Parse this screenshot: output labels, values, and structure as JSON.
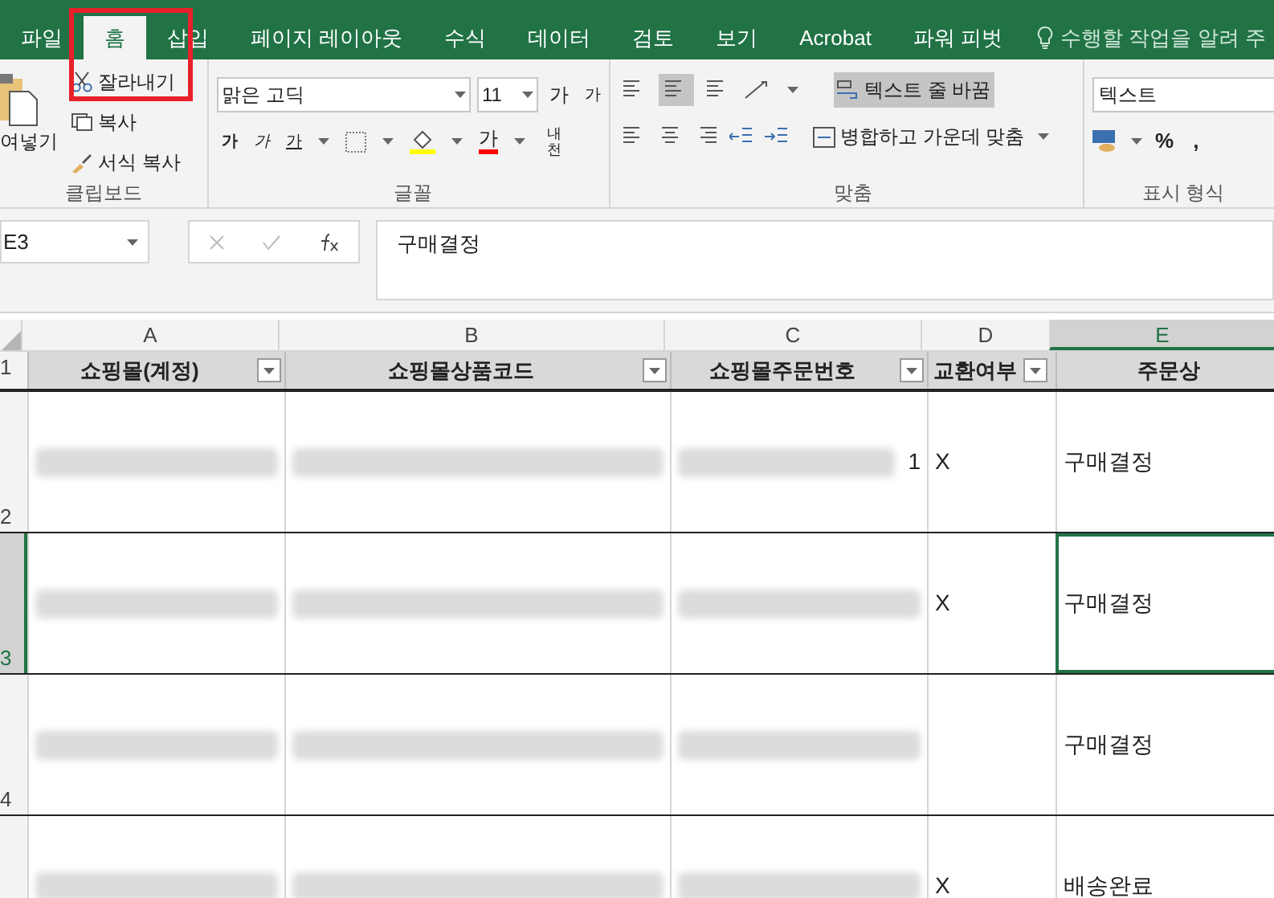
{
  "ribbon_tabs": [
    {
      "label": "파일",
      "selected": false
    },
    {
      "label": "홈",
      "selected": true
    },
    {
      "label": "삽입",
      "selected": false
    },
    {
      "label": "페이지 레이아웃",
      "selected": false
    },
    {
      "label": "수식",
      "selected": false
    },
    {
      "label": "데이터",
      "selected": false
    },
    {
      "label": "검토",
      "selected": false
    },
    {
      "label": "보기",
      "selected": false
    },
    {
      "label": "Acrobat",
      "selected": false
    },
    {
      "label": "파워 피벗",
      "selected": false
    }
  ],
  "tell_me": "수행할 작업을 알려 주",
  "clipboard": {
    "paste": "여넣기",
    "cut": "잘라내기",
    "copy": "복사",
    "format_painter": "서식 복사",
    "group": "클립보드"
  },
  "font": {
    "name": "맑은 고딕",
    "size": "11",
    "grow": "가",
    "shrink": "가",
    "bold": "가",
    "italic": "가",
    "underline": "가",
    "font_color": "가",
    "phonetic": "내천",
    "group": "글꼴"
  },
  "alignment": {
    "wrap_text": "텍스트 줄 바꿈",
    "wrap_selected": true,
    "merge": "병합하고 가운데 맞춤",
    "middle_selected": true,
    "group": "맞춤"
  },
  "number": {
    "format": "텍스트",
    "percent": "%",
    "comma": ",",
    "group": "표시 형식"
  },
  "name_box": "E3",
  "formula": "구매결정",
  "header_row_number": "1",
  "columns": [
    {
      "letter": "A",
      "header": "쇼핑몰(계정)",
      "selected": false
    },
    {
      "letter": "B",
      "header": "쇼핑몰상품코드",
      "selected": false
    },
    {
      "letter": "C",
      "header": "쇼핑몰주문번호",
      "selected": false
    },
    {
      "letter": "D",
      "header": "교환여부",
      "selected": false
    },
    {
      "letter": "E",
      "header": "주문상",
      "selected": true
    }
  ],
  "rows": [
    {
      "number": "2",
      "selected": false,
      "cells": [
        {
          "blurred": true
        },
        {
          "blurred": true
        },
        {
          "blurred": true,
          "text": "1"
        },
        {
          "text": "X"
        },
        {
          "text": "구매결정"
        }
      ]
    },
    {
      "number": "3",
      "selected": true,
      "cells": [
        {
          "blurred": true
        },
        {
          "blurred": true
        },
        {
          "blurred": true
        },
        {
          "text": "X"
        },
        {
          "text": "구매결정",
          "active": true
        }
      ]
    },
    {
      "number": "4",
      "selected": false,
      "cells": [
        {
          "blurred": true
        },
        {
          "blurred": true
        },
        {
          "blurred": true
        },
        {},
        {
          "text": "구매결정"
        }
      ]
    },
    {
      "selected": false,
      "cells": [
        {
          "blurred": true
        },
        {
          "blurred": true
        },
        {
          "blurred": true
        },
        {
          "text": "X"
        },
        {
          "text": "배송완료"
        }
      ]
    }
  ]
}
